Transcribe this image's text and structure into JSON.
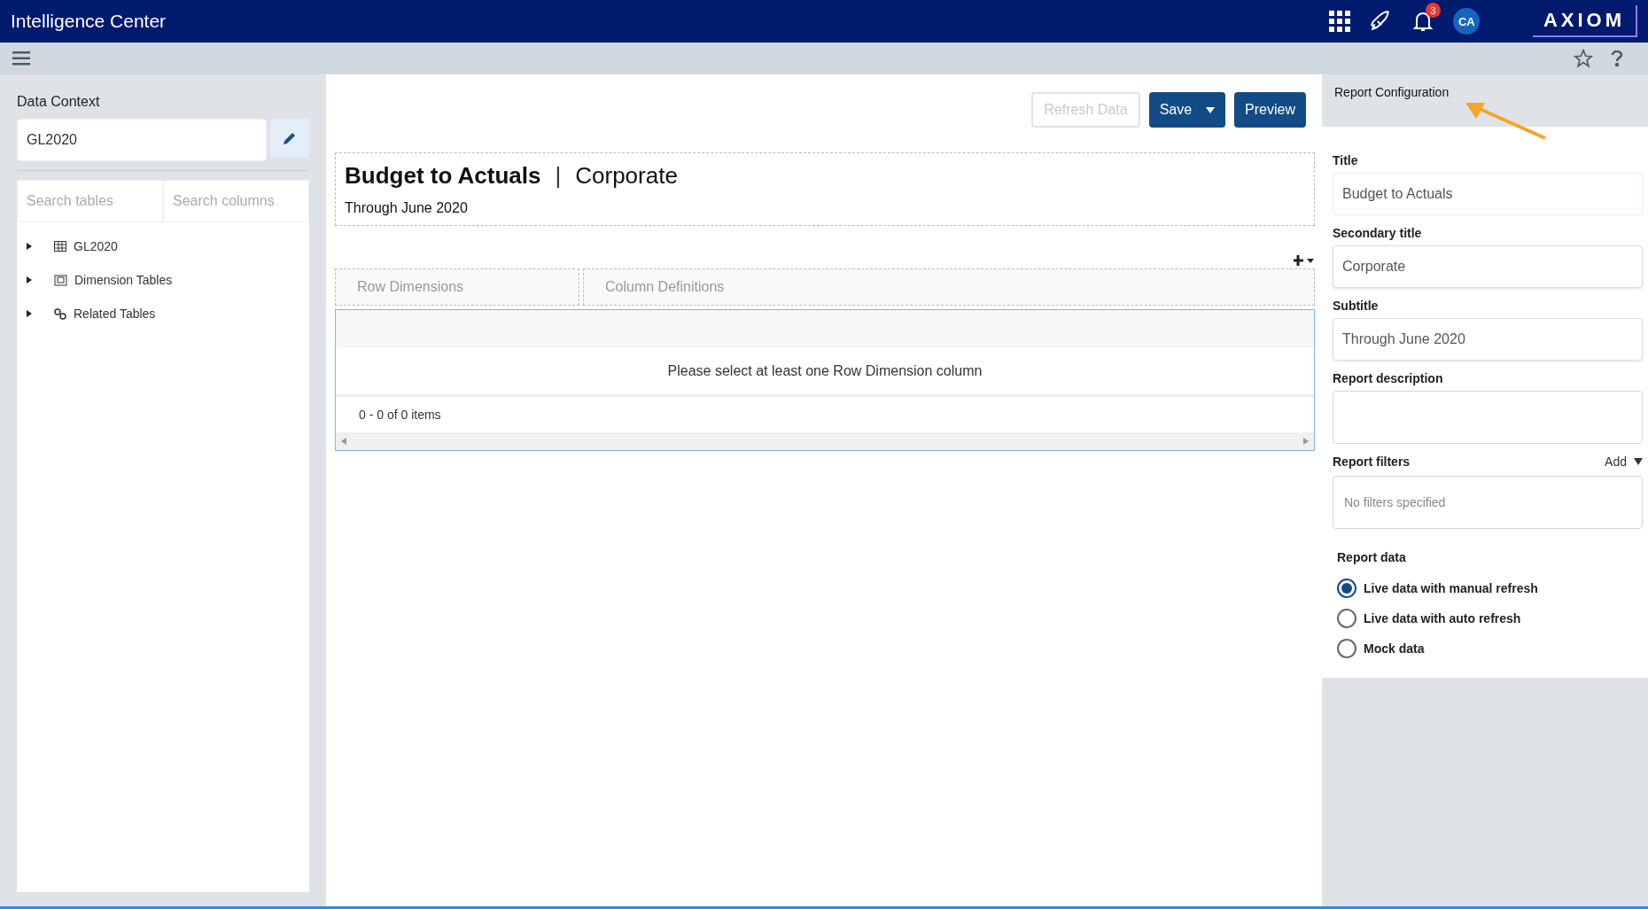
{
  "app_bar": {
    "title": "Intelligence Center",
    "notification_count": "3",
    "avatar_initials": "CA",
    "logo": "AXIOM"
  },
  "data_context": {
    "label": "Data Context",
    "value": "GL2020",
    "search_tables": {
      "placeholder": "Search tables"
    },
    "search_columns": {
      "placeholder": "Search columns"
    },
    "tree": [
      {
        "label": "GL2020",
        "kind": "table",
        "expanded": false
      },
      {
        "label": "Dimension Tables",
        "kind": "dimension",
        "expanded": false
      },
      {
        "label": "Related Tables",
        "kind": "related",
        "expanded": false
      }
    ]
  },
  "actions": [
    {
      "label": "Refresh Data",
      "kind": "plain",
      "disabled": true
    },
    {
      "label": "Save",
      "kind": "split",
      "disabled": false
    },
    {
      "label": "Preview",
      "kind": "plain",
      "disabled": false
    }
  ],
  "report_header": {
    "title": "Budget to Actuals",
    "separator": "|",
    "secondary_title": "Corporate",
    "subtitle": "Through June 2020"
  },
  "grid": {
    "zones": [
      "Row Dimensions",
      "Column Definitions"
    ],
    "empty_message": "Please select at least one Row Dimension column",
    "pager": "0 - 0 of 0 items"
  },
  "config": {
    "header": "Report Configuration",
    "fields": [
      {
        "label": "Title",
        "value": "Budget to Actuals",
        "focused": true
      },
      {
        "label": "Secondary title",
        "value": "Corporate",
        "focused": false
      },
      {
        "label": "Subtitle",
        "value": "Through June 2020",
        "focused": false
      },
      {
        "label": "Report description",
        "kind": "multiline",
        "focused": false
      }
    ],
    "filters": {
      "label": "Report filters",
      "add": "Add",
      "empty": "No filters specified"
    },
    "report_data": {
      "label": "Report data",
      "options": [
        {
          "label": "Live data with manual refresh",
          "selected": true
        },
        {
          "label": "Live data with auto refresh",
          "selected": false
        },
        {
          "label": "Mock data",
          "selected": false
        }
      ]
    }
  }
}
